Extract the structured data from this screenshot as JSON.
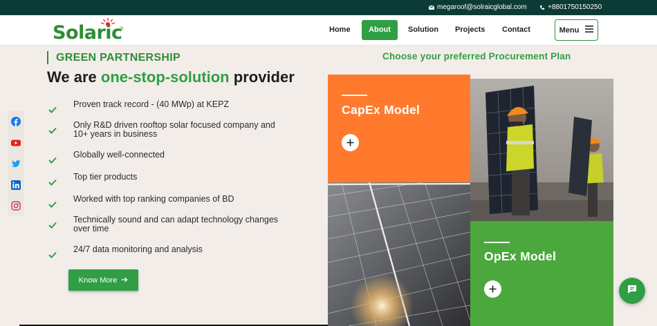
{
  "topbar": {
    "email": "megaroof@solraicglobal.com",
    "phone": "+8801750150250",
    "icons": [
      "mail-icon",
      "phone-icon"
    ]
  },
  "logo": {
    "text": "Solaric",
    "mark": "®"
  },
  "nav": {
    "items": [
      {
        "label": "Home",
        "active": false
      },
      {
        "label": "About",
        "active": true
      },
      {
        "label": "Solution",
        "active": false
      },
      {
        "label": "Projects",
        "active": false
      },
      {
        "label": "Contact",
        "active": false
      }
    ],
    "menu_label": "Menu"
  },
  "intro": {
    "eyebrow": "GREEN PARTNERSHIP",
    "headline_prefix": "We are",
    "headline_highlight": "one-stop-solution",
    "headline_suffix": "provider",
    "features": [
      "Proven track record - (40 MWp) at KEPZ",
      "Only R&D driven rooftop solar focused company and 10+ years in business",
      "Globally well-connected",
      "Top tier products",
      "Worked with top ranking companies of BD",
      "Technically sound and can adapt technology changes over time",
      "24/7 data monitoring and analysis"
    ],
    "button_label": "Know More"
  },
  "social": [
    "facebook-icon",
    "youtube-icon",
    "twitter-icon",
    "linkedin-icon",
    "instagram-icon"
  ],
  "procurement": {
    "title": "Choose your preferred Procurement Plan",
    "capex": "CapEx Model",
    "opex": "OpEx Model"
  },
  "colors": {
    "brand_green": "#2f9e44",
    "dark_teal": "#0c3b36",
    "capex_orange": "#ff7a2c",
    "opex_green": "#4ba83c",
    "page_bg": "#f3ede9"
  }
}
